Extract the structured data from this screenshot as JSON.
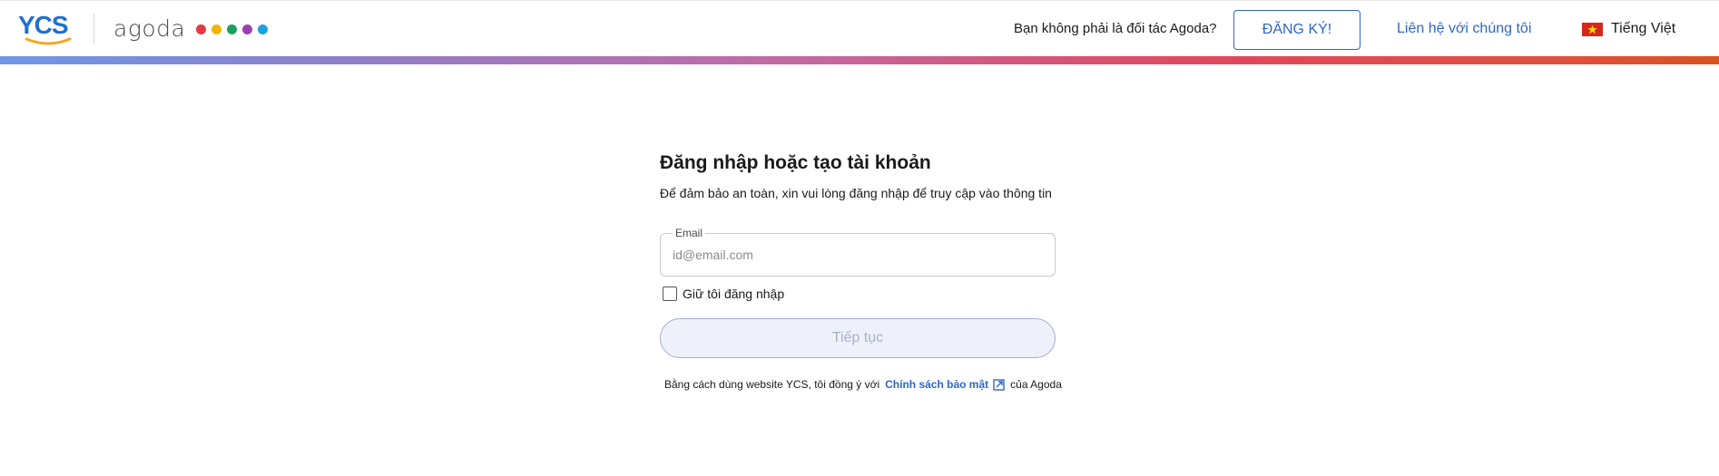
{
  "header": {
    "logo_ycs": "YCS",
    "logo_agoda": "agoda",
    "agoda_dot_colors": [
      "#e63946",
      "#f4b400",
      "#1aa260",
      "#9b3fb5",
      "#1da1e0"
    ],
    "not_partner_text": "Bạn không phải là đối tác Agoda?",
    "signup_label": "ĐĂNG KÝ!",
    "contact_label": "Liên hệ với chúng tôi",
    "language_label": "Tiếng Việt",
    "language_flag_icon": "vietnam-flag-icon"
  },
  "login": {
    "title": "Đăng nhập hoặc tạo tài khoản",
    "subtitle": "Để đảm bảo an toàn, xin vui lòng đăng nhập để truy cập vào thông tin",
    "email_label": "Email",
    "email_placeholder": "id@email.com",
    "email_value": "",
    "remember_label": "Giữ tôi đăng nhập",
    "remember_checked": false,
    "continue_label": "Tiếp tục",
    "terms_prefix": "Bằng cách dùng website YCS, tôi đồng ý với",
    "terms_link": "Chính sách bảo mật",
    "terms_suffix": "của Agoda"
  },
  "colors": {
    "accent": "#2f66c9",
    "button_disabled_bg": "#eef1fa"
  }
}
